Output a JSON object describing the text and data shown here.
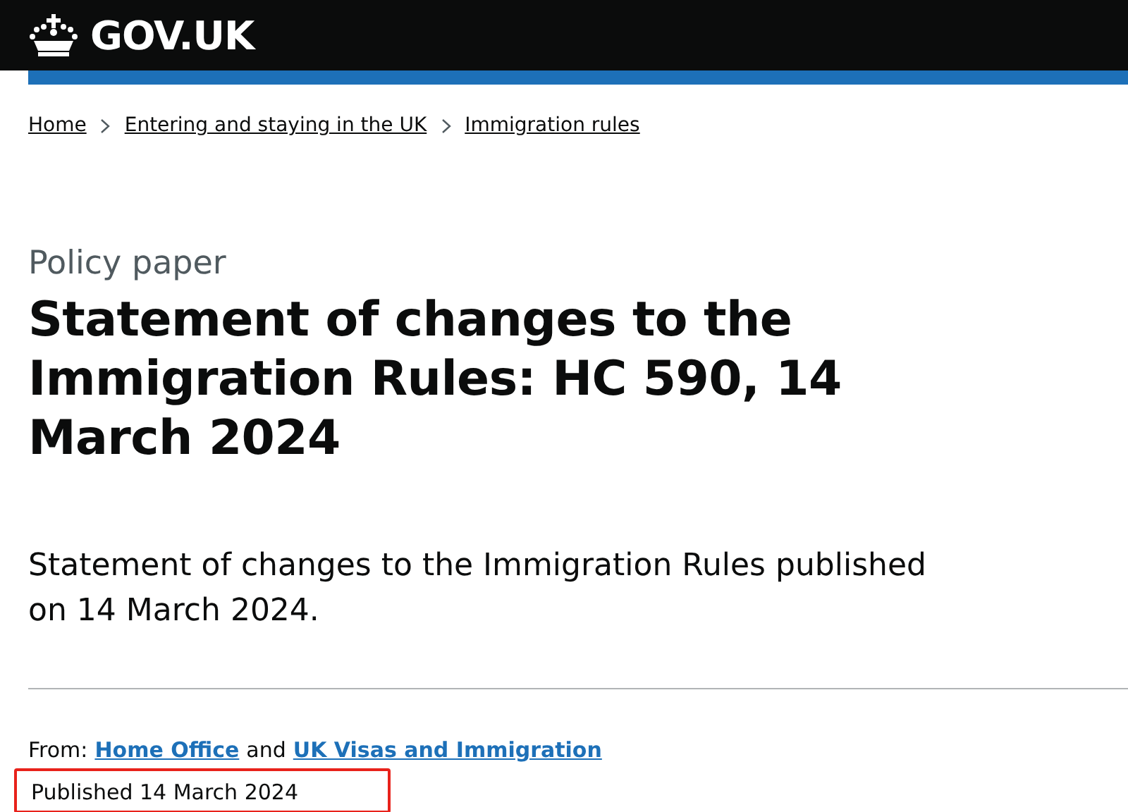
{
  "header": {
    "logo_text": "GOV.UK"
  },
  "breadcrumbs": [
    {
      "label": "Home"
    },
    {
      "label": "Entering and staying in the UK"
    },
    {
      "label": "Immigration rules"
    }
  ],
  "caption": "Policy paper",
  "title": "Statement of changes to the Immigration Rules: HC 590, 14 March 2024",
  "summary": "Statement of changes to the Immigration Rules published on 14 March 2024.",
  "metadata": {
    "from_label": "From:",
    "organisations": [
      "Home Office",
      "UK Visas and Immigration"
    ],
    "joiner": "and",
    "published": "Published 14 March 2024",
    "highlighted": true
  }
}
